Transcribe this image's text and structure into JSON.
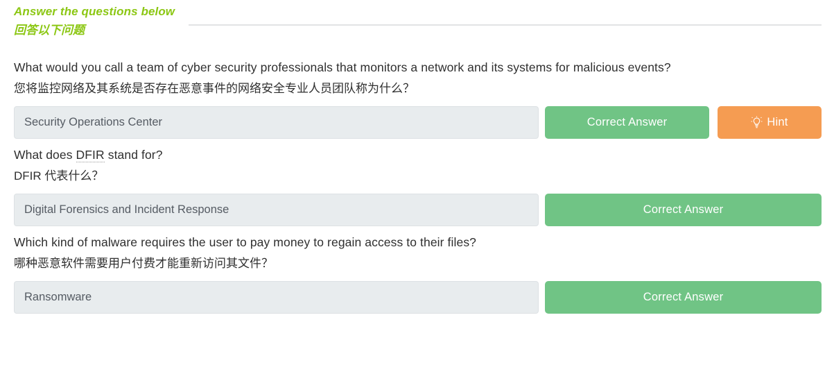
{
  "header": {
    "legend_en": "Answer the questions below",
    "legend_cn": "回答以下问题"
  },
  "labels": {
    "correct_answer": "Correct Answer",
    "hint": "Hint",
    "hint_icon": "lightbulb-icon"
  },
  "questions": [
    {
      "text_en_before": "What would you call a team of cyber security professionals that monitors a network and its systems for malicious events?",
      "text_abbr": "",
      "text_en_after": "",
      "text_cn": "您将监控网络及其系统是否存在恶意事件的网络安全专业人员团队称为什么？",
      "answer_value": "Security Operations Center",
      "answer_placeholder": "",
      "button_label": "Correct Answer",
      "hint_label": "Hint",
      "has_hint": true
    },
    {
      "text_en_before": "What does ",
      "text_abbr": "DFIR",
      "text_en_after": " stand for?",
      "text_cn": "DFIR 代表什么？",
      "answer_value": "Digital Forensics and Incident Response",
      "answer_placeholder": "",
      "button_label": "Correct Answer",
      "hint_label": "",
      "has_hint": false
    },
    {
      "text_en_before": "Which kind of malware requires the user to pay money to regain access to their files?",
      "text_abbr": "",
      "text_en_after": "",
      "text_cn": "哪种恶意软件需要用户付费才能重新访问其文件？",
      "answer_value": "Ransomware",
      "answer_placeholder": "",
      "button_label": "Correct Answer",
      "hint_label": "",
      "has_hint": false
    }
  ],
  "colors": {
    "accent_green": "#8CC714",
    "button_green": "#70C485",
    "button_orange": "#F59C52",
    "input_background": "#E8ECEE",
    "divider": "#E2E3E5",
    "text": "#2F2F2F"
  }
}
